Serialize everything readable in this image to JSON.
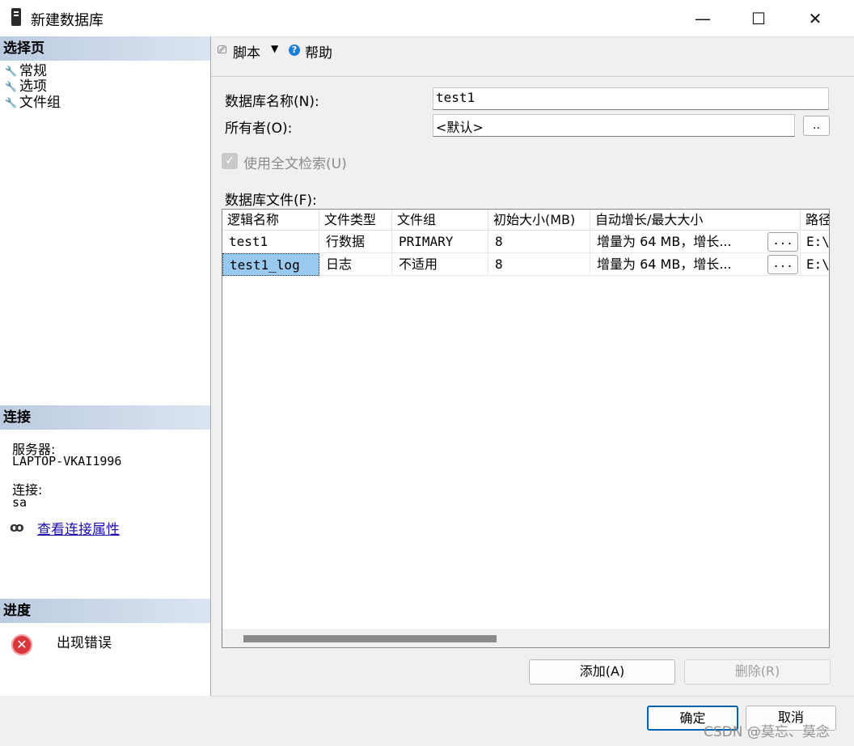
{
  "window": {
    "title": "新建数据库",
    "minimize": "—",
    "maximize": "☐",
    "close": "✕"
  },
  "left": {
    "select_page_header": "选择页",
    "pages": [
      {
        "label": "常规"
      },
      {
        "label": "选项"
      },
      {
        "label": "文件组"
      }
    ],
    "connection_header": "连接",
    "server_label": "服务器:",
    "server_value": "LAPTOP-VKAI1996",
    "connection_label": "连接:",
    "connection_value": "sa",
    "view_props_link": "查看连接属性",
    "progress_header": "进度",
    "progress_status": "出现错误"
  },
  "toolbar": {
    "script_label": "脚本",
    "help_label": "帮助"
  },
  "form": {
    "db_name_label": "数据库名称(N):",
    "db_name_value": "test1",
    "owner_label": "所有者(O):",
    "owner_value": "<默认>",
    "owner_browse": "..",
    "fulltext_label": "使用全文检索(U)",
    "fulltext_checked": true,
    "files_label": "数据库文件(F):"
  },
  "grid": {
    "columns": [
      "逻辑名称",
      "文件类型",
      "文件组",
      "初始大小(MB)",
      "自动增长/最大大小",
      "路径"
    ],
    "rows": [
      {
        "name": "test1",
        "type": "行数据",
        "filegroup": "PRIMARY",
        "size": "8",
        "growth": "增量为 64 MB，增长...",
        "browse": "...",
        "path": "E:\\S"
      },
      {
        "name": "test1_log",
        "type": "日志",
        "filegroup": "不适用",
        "size": "8",
        "growth": "增量为 64 MB，增长...",
        "browse": "...",
        "path": "E:\\S"
      }
    ],
    "selected_row": 1
  },
  "buttons": {
    "add": "添加(A)",
    "remove": "删除(R)",
    "ok": "确定",
    "cancel": "取消"
  },
  "watermark": "CSDN @莫忘、莫念"
}
